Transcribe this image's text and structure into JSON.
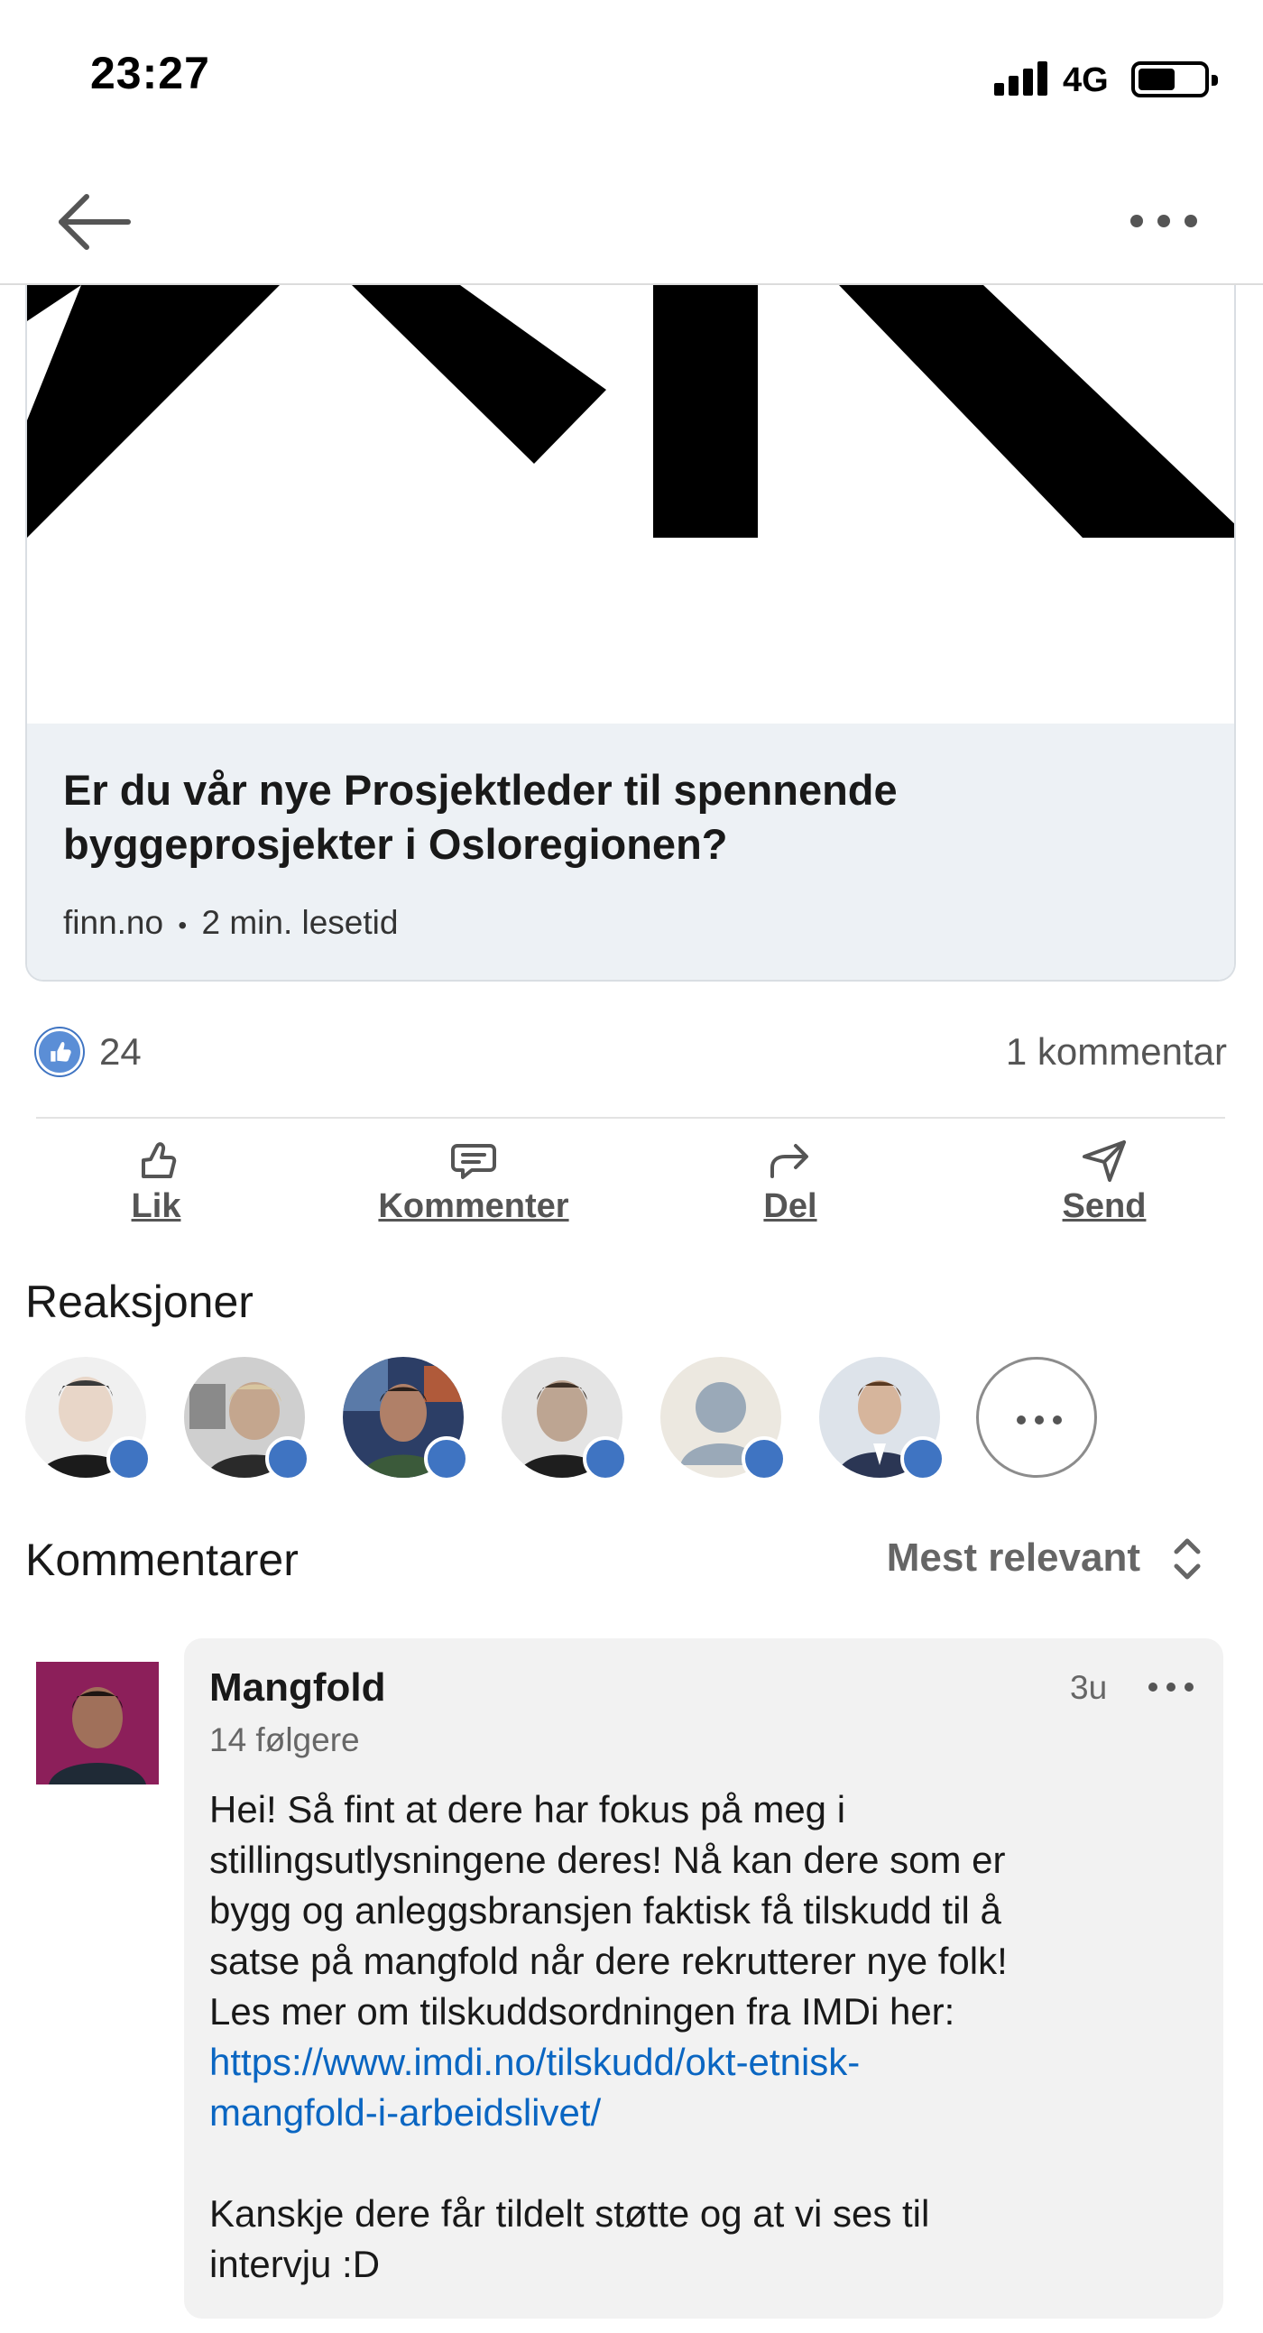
{
  "status_bar": {
    "time": "23:27",
    "network": "4G"
  },
  "article": {
    "title": "Er du vår nye Prosjektleder til spennende byggeprosjekter i Osloregionen?",
    "source": "finn.no",
    "separator": "•",
    "read_time": "2 min. lesetid"
  },
  "social": {
    "like_count": "24",
    "comment_count": "1 kommentar"
  },
  "actions": {
    "like": "Lik",
    "comment": "Kommenter",
    "share": "Del",
    "send": "Send"
  },
  "reactions": {
    "heading": "Reaksjoner",
    "items": [
      {
        "icon": "avatar-photo"
      },
      {
        "icon": "avatar-photo"
      },
      {
        "icon": "avatar-photo"
      },
      {
        "icon": "avatar-photo"
      },
      {
        "icon": "avatar-placeholder"
      },
      {
        "icon": "avatar-photo"
      }
    ]
  },
  "comments": {
    "heading": "Kommentarer",
    "sort_label": "Mest relevant",
    "items": [
      {
        "author": "Mangfold",
        "followers": "14 følgere",
        "time": "3u",
        "body_lines": [
          "Hei! Så fint at dere har fokus på meg i",
          "stillingsutlysningene deres! Nå kan dere som er",
          "bygg og anleggsbransjen faktisk få tilskudd til å",
          "satse på mangfold når dere rekrutterer nye folk!",
          "Les mer om tilskuddsordningen fra IMDi her:"
        ],
        "link_lines": [
          "https://www.imdi.no/tilskudd/okt-etnisk-",
          "mangfold-i-arbeidslivet/"
        ],
        "closing_lines": [
          "Kanskje dere får tildelt støtte og at vi ses til",
          "intervju :D"
        ]
      }
    ]
  },
  "colors": {
    "accent": "#0a66c2",
    "like_blue": "#3f74c2",
    "card_info_bg": "#edf1f5",
    "comment_bg": "#f2f2f2"
  }
}
